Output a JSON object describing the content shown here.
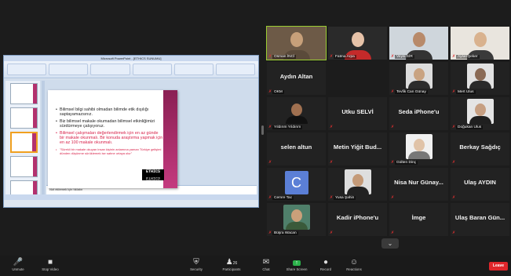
{
  "shared_screen": {
    "window_title": "Microsoft PowerPoint - [ETHICS SUNUMU]",
    "notes_placeholder": "Not eklemek için tıklatın",
    "slide": {
      "bullets": [
        {
          "text": "Bilimsel bilgi sahibi olmadan bilimde etik dışılığı saptayamazsınız.",
          "style": "normal"
        },
        {
          "text": "Biz bilimsel makale okumadan bilimsel etkinliğimizi sürdürmeye çalışıyoruz.",
          "style": "normal"
        },
        {
          "text": "Bilimsel çalışmaları değerlendirmek için en az günde bir makale okunmalı. Bir konuda araştırma yapmak için en az 100 makale okunmalı.",
          "style": "red"
        },
        {
          "text": "\"Sürekli bir makale okuyan insan kişinin anlamına yaman Türkiye gelişimi dünden düşünme sürüklemek ise sahne ortaya olur\"",
          "style": "red-small"
        }
      ],
      "logo_text": "ETHICS"
    }
  },
  "gallery": {
    "tiles": [
      {
        "name": "Osman İNCİ",
        "kind": "video",
        "speaking": true,
        "skin": "#c7a07a",
        "cloth": "#5a4a3a",
        "bg": "#6d5a47"
      },
      {
        "name": "Fatma Arpa",
        "kind": "video",
        "skin": "#e6c2a8",
        "cloth": "#c42a2a",
        "bg": "#2a2a2a"
      },
      {
        "name": "Veysi SİR",
        "kind": "video",
        "skin": "#b88a6a",
        "cloth": "#333",
        "bg": "#cfd6dc"
      },
      {
        "name": "Aysel Şeker",
        "kind": "video",
        "skin": "#d9b28e",
        "cloth": "#3a3a3a",
        "bg": "#e9e5de"
      },
      {
        "name": "OKM",
        "kind": "text",
        "big": "Aydın Altan"
      },
      {
        "name": "",
        "kind": "text",
        "big": "Aydın Altan",
        "hidden": true
      },
      {
        "name": "Tevfik Can Günay",
        "kind": "thumb",
        "skin": "#c9a381",
        "cloth": "#2c2c2c",
        "bg": "#dcdcdc"
      },
      {
        "name": "Mert Ulus",
        "kind": "thumb",
        "skin": "#8a6a55",
        "cloth": "#2a2a2a",
        "bg": "#e2e2e2"
      },
      {
        "name": "Yıldırım Yıldırım",
        "kind": "thumb",
        "skin": "#a07050",
        "cloth": "#111",
        "bg": "#222"
      },
      {
        "name": "",
        "kind": "text",
        "big": "Utku SELVİ"
      },
      {
        "name": "",
        "kind": "text",
        "big": "Seda iPhone'u"
      },
      {
        "name": "Doğukan Ulus",
        "kind": "thumb",
        "skin": "#c69f82",
        "cloth": "#1f1f1f",
        "bg": "#e4e4e4"
      },
      {
        "name": "",
        "kind": "text",
        "big": "selen altun"
      },
      {
        "name": "",
        "kind": "text",
        "big": "Metin Yiğit Bud..."
      },
      {
        "name": "Gülten Dinç",
        "kind": "thumb",
        "skin": "#e0c3a8",
        "cloth": "#777",
        "bg": "#f0f0f0"
      },
      {
        "name": "",
        "kind": "text",
        "big": "Berkay Sağdıç"
      },
      {
        "name": "Cemre Tac",
        "kind": "avatar",
        "letter": "C"
      },
      {
        "name": "Yusa Şahin",
        "kind": "thumb",
        "skin": "#c49a78",
        "cloth": "#222",
        "bg": "#dedede"
      },
      {
        "name": "",
        "kind": "text",
        "big": "Nisa Nur Günay..."
      },
      {
        "name": "",
        "kind": "text",
        "big": "Ulaş AYDIN"
      },
      {
        "name": "Büşra Wacan",
        "kind": "thumb",
        "skin": "#caa07a",
        "cloth": "#3a5a3a",
        "bg": "#4f7f6a"
      },
      {
        "name": "",
        "kind": "text",
        "big": "Kadir iPhone'u"
      },
      {
        "name": "",
        "kind": "text",
        "big": "İmge"
      },
      {
        "name": "",
        "kind": "text",
        "big": "Ulaş Baran Gün..."
      }
    ]
  },
  "toolbar": {
    "unmute": "Unmute",
    "stop_video": "Stop Video",
    "security": "Security",
    "participants": "Participants",
    "participants_count": "26",
    "chat": "Chat",
    "share_screen": "Share Screen",
    "record": "Record",
    "reactions": "Reactions",
    "leave": "Leave"
  },
  "colors": {
    "accent_green": "#2bb14a",
    "leave_red": "#e0262b",
    "slide_band": "#b3316e"
  }
}
